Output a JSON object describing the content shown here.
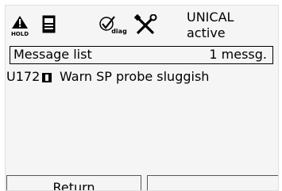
{
  "header": {
    "icons": [
      "hold-icon",
      "sensor-card-icon",
      "diag-icon",
      "tools-icon"
    ],
    "hold_label": "HOLD",
    "diag_label": "diag",
    "status_line1": "UNICAL",
    "status_line2": "active"
  },
  "message_bar": {
    "title": "Message list",
    "count": "1 messg."
  },
  "messages": [
    {
      "code": "U172",
      "text": "Warn SP probe sluggish"
    }
  ],
  "softkeys": {
    "left_label": "Return",
    "right_label": ""
  }
}
